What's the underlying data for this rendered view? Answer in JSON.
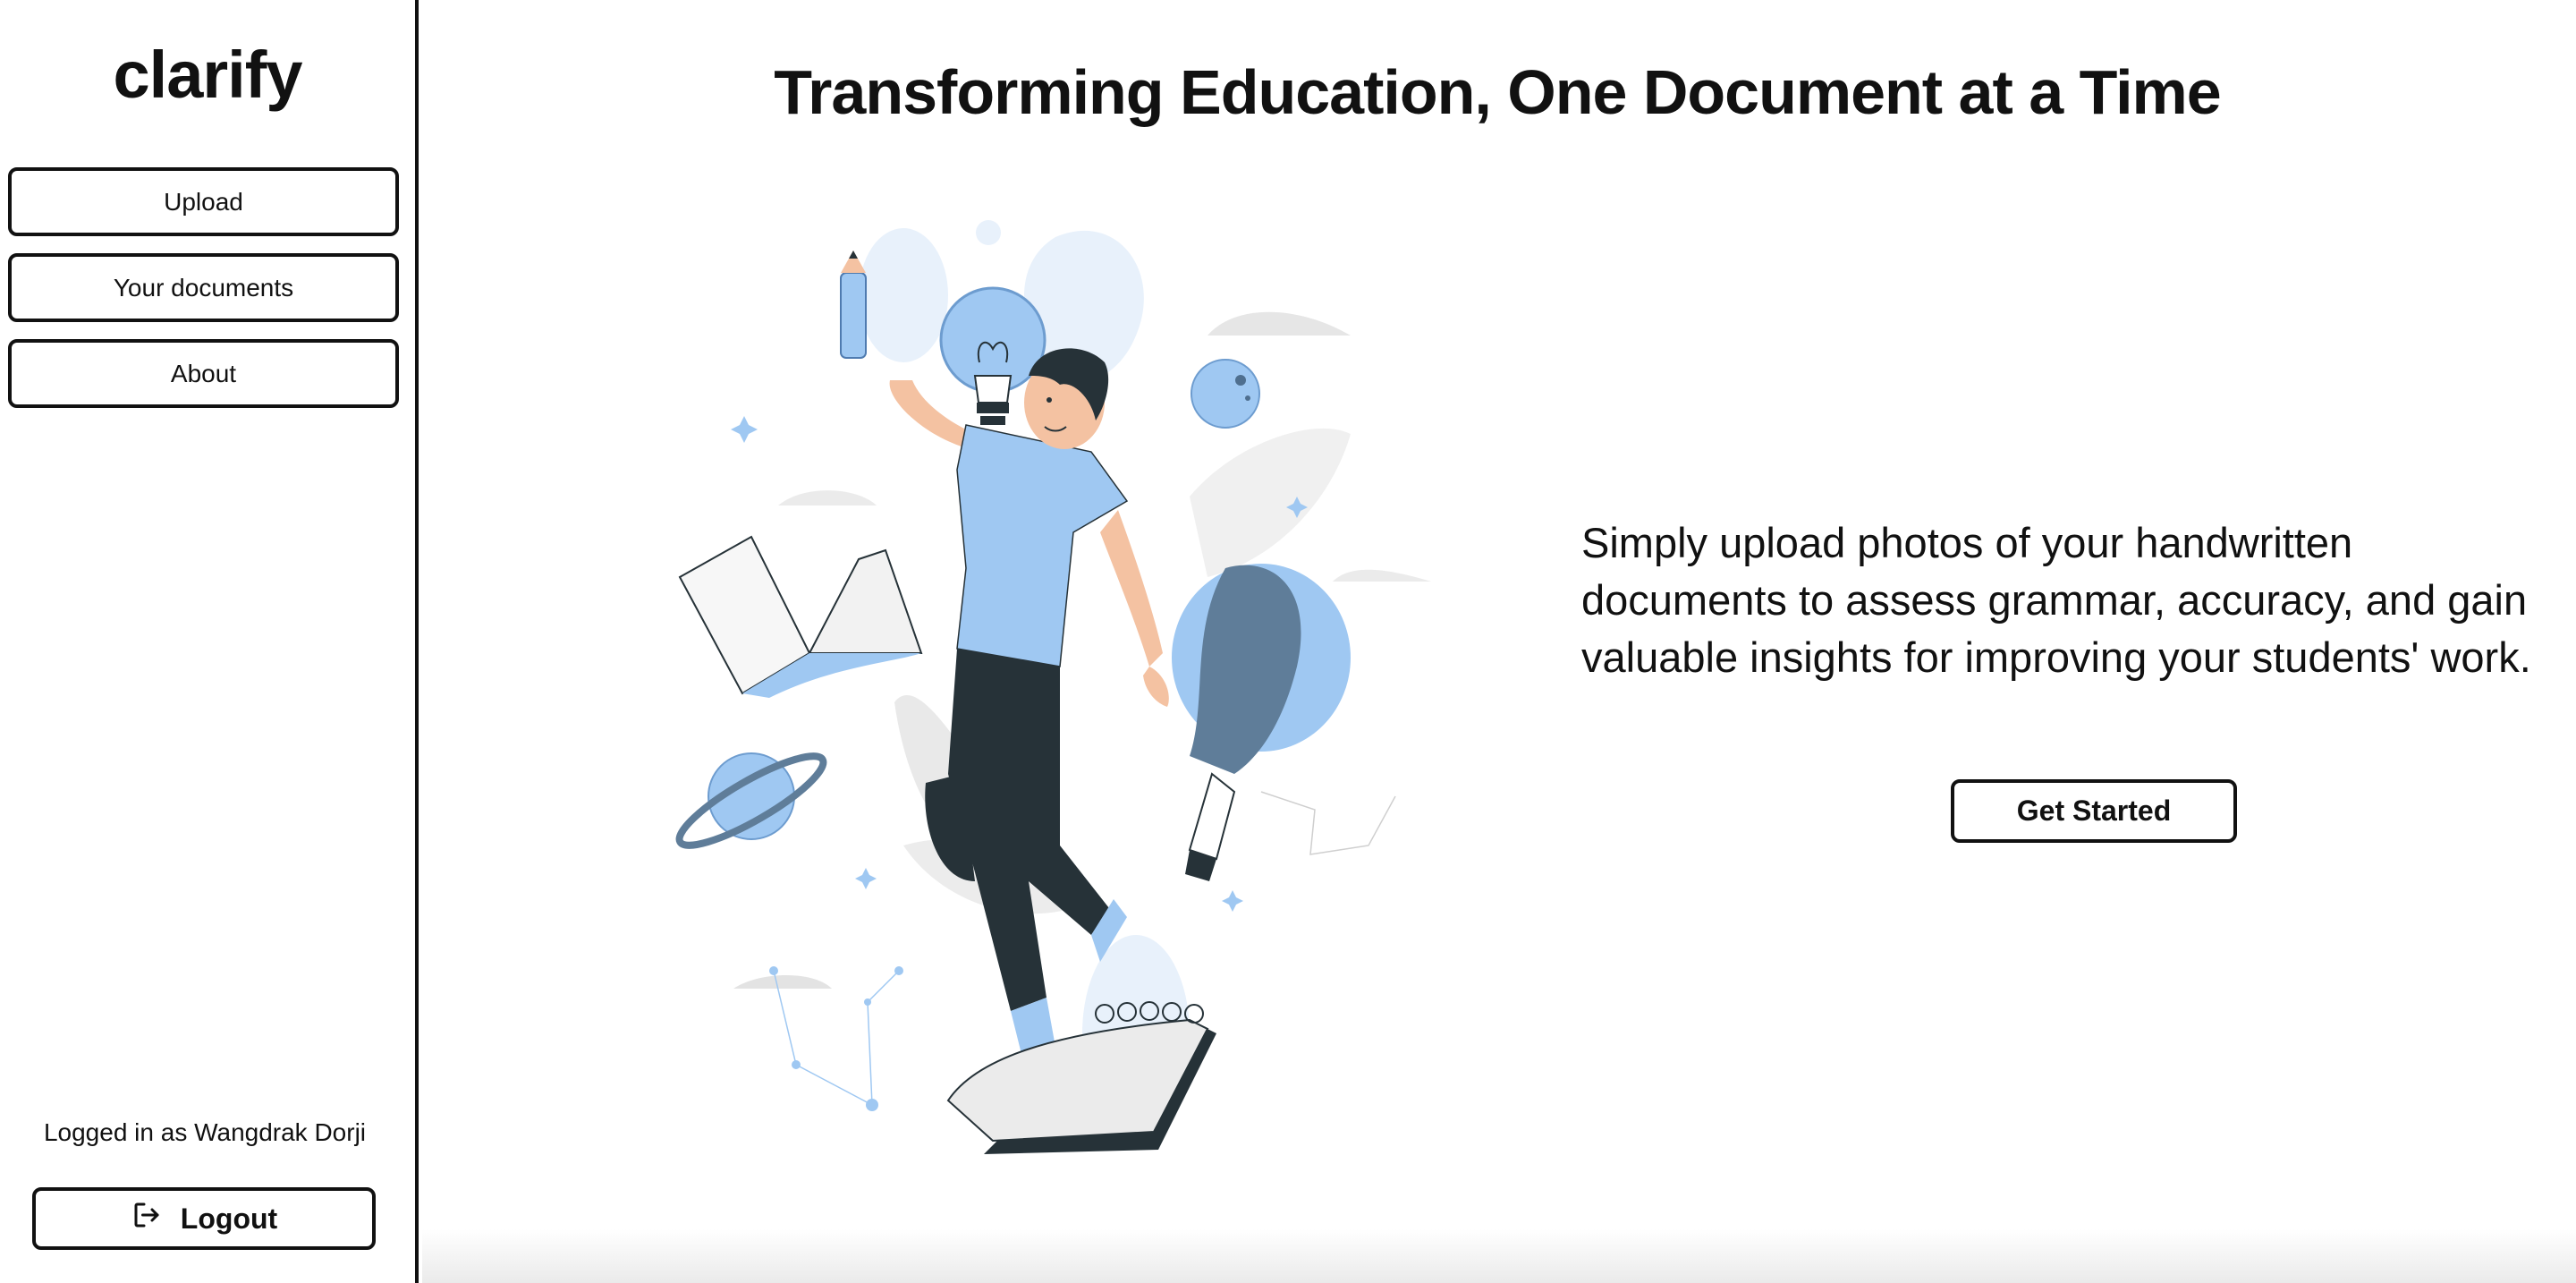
{
  "app": {
    "name": "clarify"
  },
  "sidebar": {
    "items": [
      {
        "label": "Upload"
      },
      {
        "label": "Your documents"
      },
      {
        "label": "About"
      }
    ],
    "user_status": "Logged in as Wangdrak Dorji",
    "logout_label": "Logout"
  },
  "main": {
    "title": "Transforming Education, One Document at a Time",
    "tagline": "Simply upload photos of your handwritten documents to assess grammar, accuracy, and gain valuable insights for improving your students' work.",
    "cta_label": "Get Started",
    "illustration_name": "person-with-education-items"
  },
  "colors": {
    "accent_blue": "#9fc8f2",
    "dark": "#263238",
    "border": "#111111",
    "light_gray": "#ebebeb"
  }
}
